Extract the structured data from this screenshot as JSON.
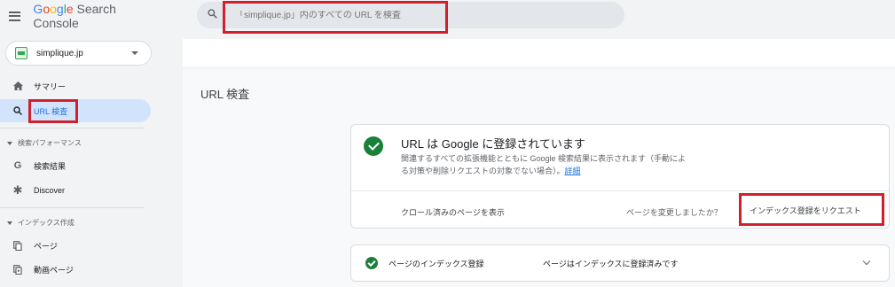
{
  "app": {
    "title_parts": [
      "G",
      "o",
      "o",
      "g",
      "l",
      "e"
    ],
    "title_rest": " Search Console"
  },
  "search": {
    "placeholder": "「simplique.jp」内のすべての URL を検査"
  },
  "property": {
    "name": "simplique.jp"
  },
  "sidebar": {
    "items": [
      {
        "label": "サマリー",
        "icon": "home-icon"
      },
      {
        "label": "URL 検査",
        "icon": "search-icon",
        "active": true
      }
    ],
    "section_performance": "検索パフォーマンス",
    "performance_items": [
      {
        "label": "検索結果",
        "icon": "google-g-icon"
      },
      {
        "label": "Discover",
        "icon": "asterisk-icon"
      }
    ],
    "section_index": "インデックス作成",
    "index_items": [
      {
        "label": "ページ",
        "icon": "pages-icon"
      },
      {
        "label": "動画ページ",
        "icon": "video-pages-icon"
      }
    ]
  },
  "main": {
    "page_title": "URL 検査",
    "result_card": {
      "title": "URL は Google に登録されています",
      "desc_line1": "関連するすべての拡張機能とともに Google 検索結果に表示されます（手動によ",
      "desc_line2": "る対策や削除リクエストの対象でない場合）。",
      "details_link": "詳細",
      "crawl_link": "クロール済みのページを表示",
      "changed_text": "ページを変更しましたか？",
      "request_button": "インデックス登録をリクエスト"
    },
    "index_row": {
      "label": "ページのインデックス登録",
      "status": "ページはインデックスに登録済みです"
    }
  },
  "colors": {
    "accent": "#1a73e8",
    "success": "#188038",
    "highlight": "#d0202e",
    "active_nav": "#d2e3fc"
  }
}
